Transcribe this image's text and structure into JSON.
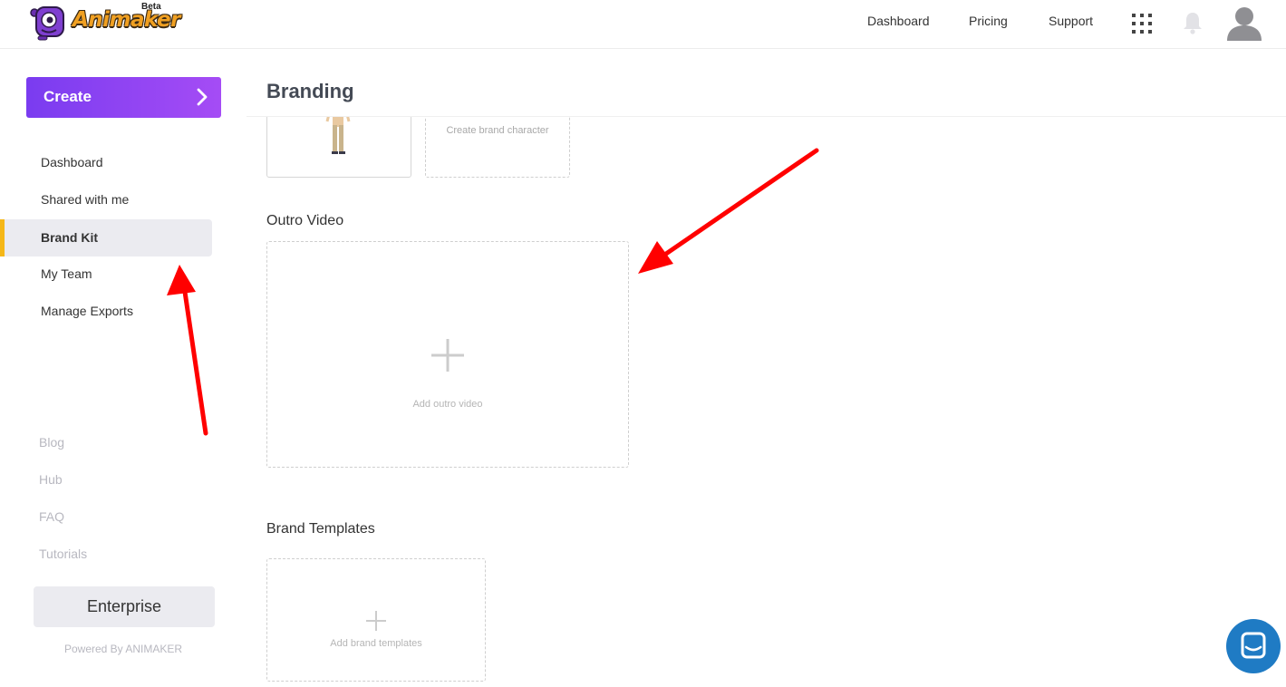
{
  "header": {
    "logo_text": "Animaker",
    "logo_badge": "Beta",
    "nav": [
      "Dashboard",
      "Pricing",
      "Support"
    ]
  },
  "sidebar": {
    "create_label": "Create",
    "items": [
      {
        "label": "Dashboard",
        "active": false
      },
      {
        "label": "Shared with me",
        "active": false
      },
      {
        "label": "Brand Kit",
        "active": true
      },
      {
        "label": "My Team",
        "active": false
      },
      {
        "label": "Manage Exports",
        "active": false
      }
    ],
    "secondary": [
      "Blog",
      "Hub",
      "FAQ",
      "Tutorials"
    ],
    "enterprise_label": "Enterprise",
    "powered_by": "Powered By ANIMAKER"
  },
  "main": {
    "title": "Branding",
    "character": {
      "create_label": "Create brand character"
    },
    "outro": {
      "title": "Outro Video",
      "add_label": "Add outro video"
    },
    "templates": {
      "title": "Brand Templates",
      "add_label": "Add brand templates"
    }
  },
  "colors": {
    "accent_start": "#7a3cf0",
    "accent_end": "#a54cf5",
    "active_marker": "#f5b718",
    "annotation": "#ff0000",
    "chat": "#1f7bc4"
  }
}
